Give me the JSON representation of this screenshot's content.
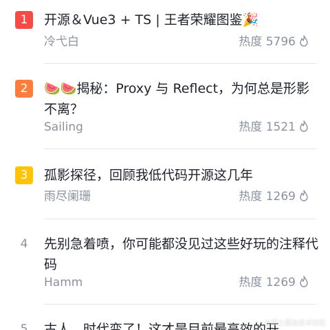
{
  "items": [
    {
      "rank": "1",
      "rank_color": "#f54a45",
      "title": "开源＆Vue3 + TS | 王者荣耀图鉴🎉",
      "author": "冷弋白",
      "heat": "热度 5796"
    },
    {
      "rank": "2",
      "rank_color": "#ff7d3c",
      "title": "🍉🍉揭秘：Proxy 与 Reflect，为何总是形影不离？",
      "author": "Sailing",
      "heat": "热度 1521"
    },
    {
      "rank": "3",
      "rank_color": "#ffc300",
      "title": "孤影探径，回顾我低代码开源这几年",
      "author": "雨尽阑珊",
      "heat": "热度 1269"
    },
    {
      "rank": "4",
      "rank_color": "",
      "title": "先别急着喷，你可能都没见过这些好玩的注释代码",
      "author": "Hamm",
      "heat": "热度 1269"
    },
    {
      "rank": "5",
      "rank_color": "",
      "title": "古人，时代变了！这才是目前最高效的开",
      "author": "",
      "heat": ""
    }
  ],
  "icons": {
    "heat": "flame-icon"
  },
  "watermark": "@稀土掘金技术社区"
}
